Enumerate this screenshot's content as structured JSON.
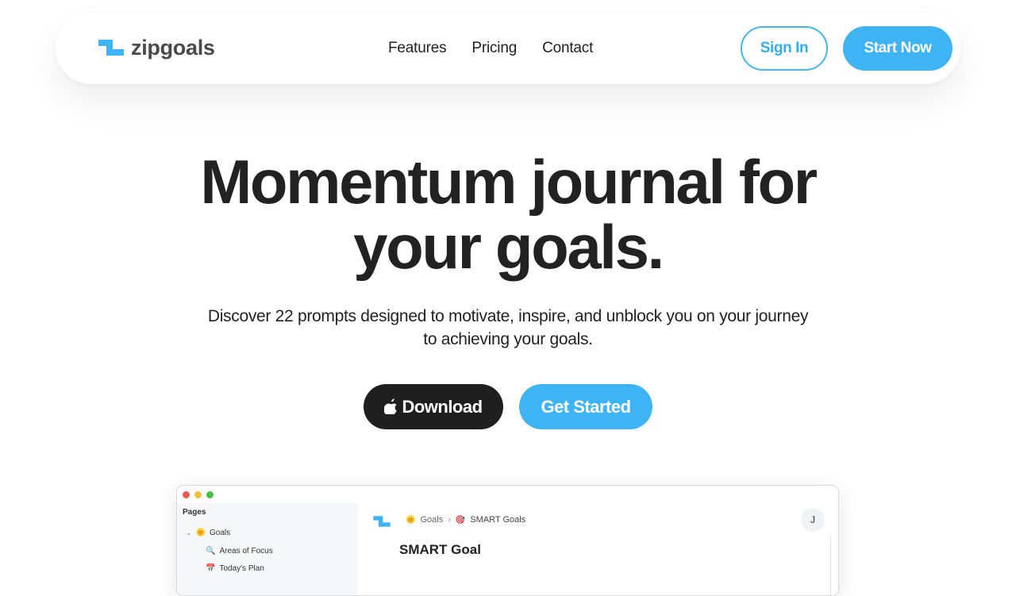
{
  "brand": {
    "name": "zipgoals"
  },
  "nav": {
    "links": [
      "Features",
      "Pricing",
      "Contact"
    ],
    "sign_in": "Sign In",
    "start_now": "Start Now"
  },
  "hero": {
    "title_line1": "Momentum journal for",
    "title_line2": "your goals.",
    "subtitle_line1": "Discover 22 prompts designed to motivate, inspire, and unblock you on your journey",
    "subtitle_line2": "to achieving your goals.",
    "download": "Download",
    "get_started": "Get Started"
  },
  "app_preview": {
    "sidebar": {
      "heading": "Pages",
      "items": [
        {
          "icon": "sun-emoji",
          "glyph": "🌞",
          "label": "Goals"
        },
        {
          "icon": "magnifier-emoji",
          "glyph": "🔍",
          "label": "Areas of Focus"
        },
        {
          "icon": "calendar-emoji",
          "glyph": "📅",
          "label": "Today's Plan"
        }
      ]
    },
    "breadcrumb": [
      {
        "icon": "sun-emoji",
        "glyph": "🌞",
        "label": "Goals"
      },
      {
        "icon": "target-emoji",
        "glyph": "🎯",
        "label": "SMART Goals"
      }
    ],
    "avatar": "J",
    "doc_title": "SMART Goal"
  },
  "colors": {
    "accent": "#3fb4f4",
    "dark": "#1f1f1f",
    "text": "#222222"
  }
}
